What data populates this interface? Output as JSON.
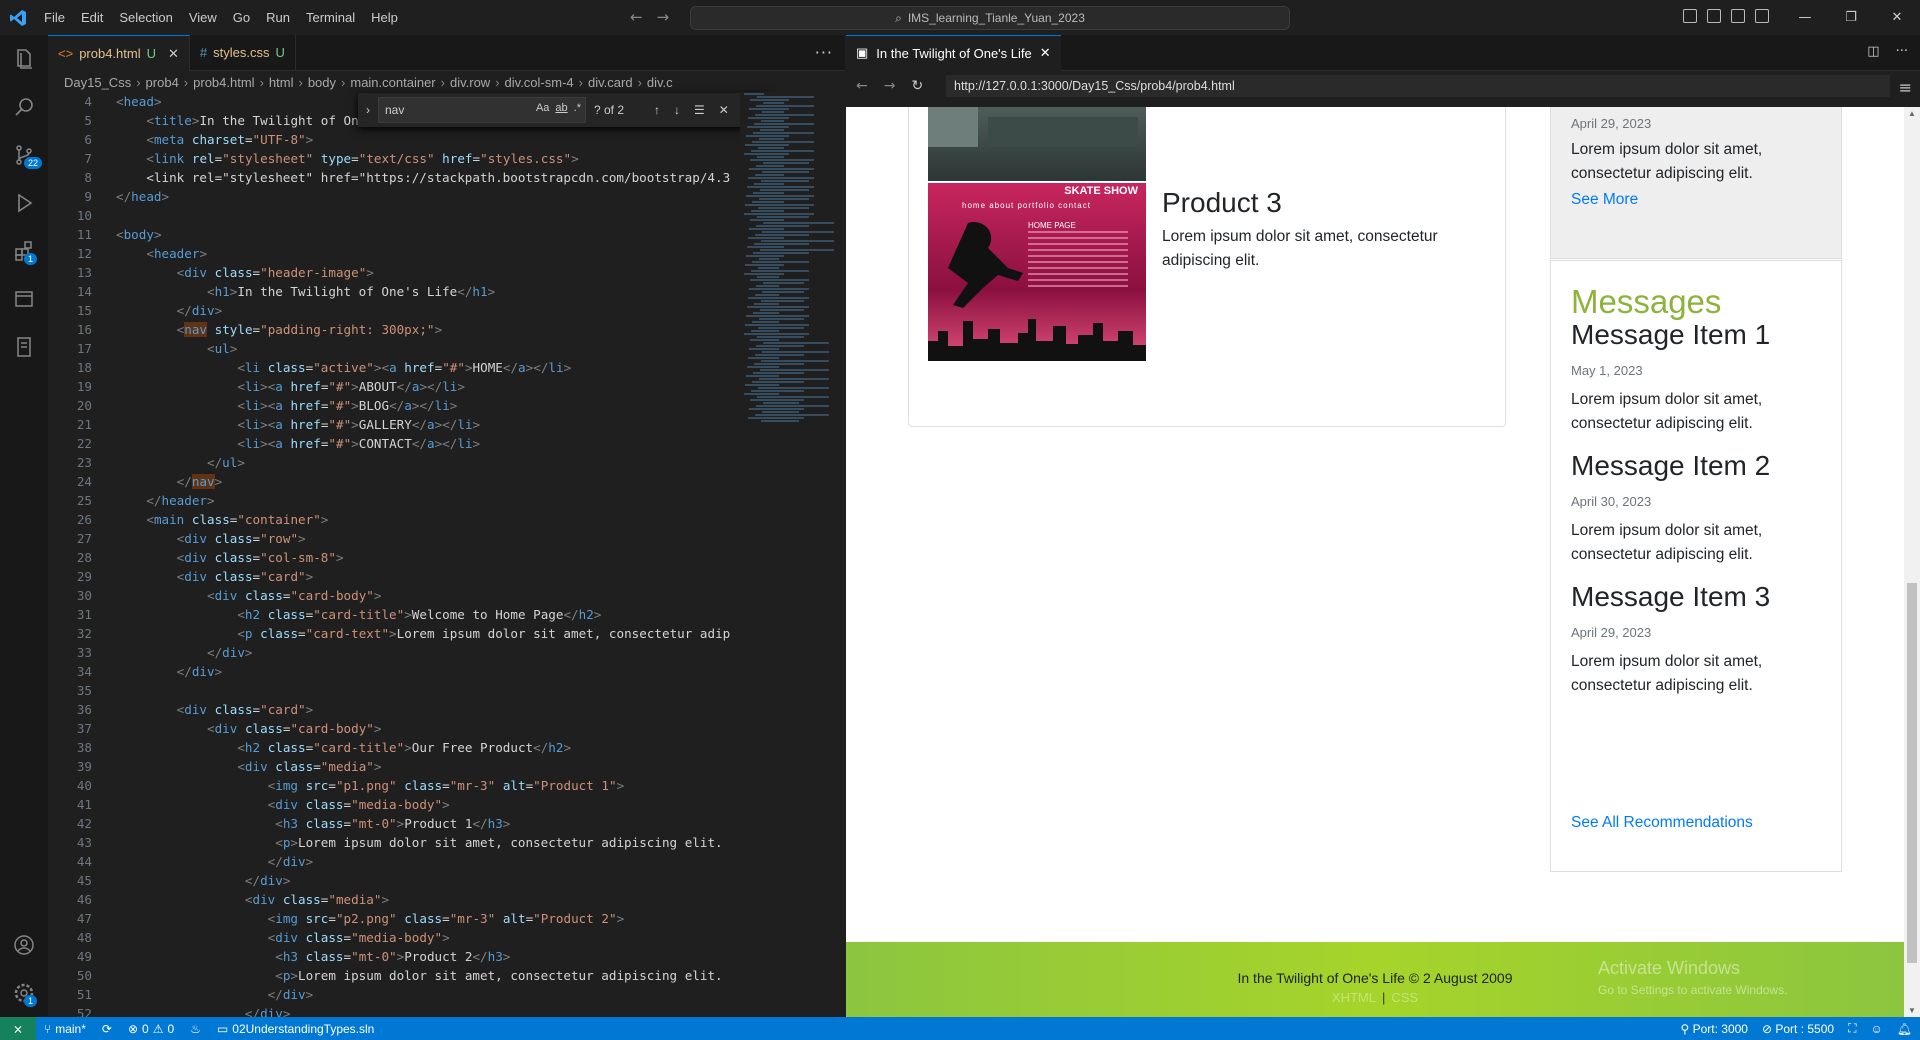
{
  "titlebar": {
    "menus": [
      "File",
      "Edit",
      "Selection",
      "View",
      "Go",
      "Run",
      "Terminal",
      "Help"
    ],
    "command_center": "IMS_learning_Tianle_Yuan_2023"
  },
  "activity": {
    "scm_badge": "22",
    "extensions_badge": "1",
    "settings_badge": "1"
  },
  "editor": {
    "tabs": [
      {
        "name": "prob4.html",
        "status": "U"
      },
      {
        "name": "styles.css",
        "status": "U"
      }
    ],
    "breadcrumb": [
      "Day15_Css",
      "prob4",
      "prob4.html",
      "html",
      "body",
      "main.container",
      "div.row",
      "div.col-sm-4",
      "div.card",
      "div.c"
    ],
    "find": {
      "query": "nav",
      "count": "? of 2",
      "opt_case": "Aa",
      "opt_word": "ab",
      "opt_regex": ".*"
    },
    "lines": [
      {
        "n": "4",
        "t": "<head>"
      },
      {
        "n": "5",
        "t": "    <title>In the Twilight of One's Life</title>"
      },
      {
        "n": "6",
        "t": "    <meta charset=\"UTF-8\">"
      },
      {
        "n": "7",
        "t": "    <link rel=\"stylesheet\" type=\"text/css\" href=\"styles.css\">"
      },
      {
        "n": "8",
        "t": "    <link rel=\"stylesheet\" href=\"https://stackpath.bootstrapcdn.com/bootstrap/4.3"
      },
      {
        "n": "9",
        "t": "</head>"
      },
      {
        "n": "10",
        "t": ""
      },
      {
        "n": "11",
        "t": "<body>"
      },
      {
        "n": "12",
        "t": "    <header>"
      },
      {
        "n": "13",
        "t": "        <div class=\"header-image\">"
      },
      {
        "n": "14",
        "t": "            <h1>In the Twilight of One's Life</h1>"
      },
      {
        "n": "15",
        "t": "        </div>"
      },
      {
        "n": "16",
        "t": "        <nav style=\"padding-right: 300px;\">"
      },
      {
        "n": "17",
        "t": "            <ul>"
      },
      {
        "n": "18",
        "t": "                <li class=\"active\"><a href=\"#\">HOME</a></li>"
      },
      {
        "n": "19",
        "t": "                <li><a href=\"#\">ABOUT</a></li>"
      },
      {
        "n": "20",
        "t": "                <li><a href=\"#\">BLOG</a></li>"
      },
      {
        "n": "21",
        "t": "                <li><a href=\"#\">GALLERY</a></li>"
      },
      {
        "n": "22",
        "t": "                <li><a href=\"#\">CONTACT</a></li>"
      },
      {
        "n": "23",
        "t": "            </ul>"
      },
      {
        "n": "24",
        "t": "        </nav>"
      },
      {
        "n": "25",
        "t": "    </header>"
      },
      {
        "n": "26",
        "t": "    <main class=\"container\">"
      },
      {
        "n": "27",
        "t": "        <div class=\"row\">"
      },
      {
        "n": "28",
        "t": "        <div class=\"col-sm-8\">"
      },
      {
        "n": "29",
        "t": "        <div class=\"card\">"
      },
      {
        "n": "30",
        "t": "            <div class=\"card-body\">"
      },
      {
        "n": "31",
        "t": "                <h2 class=\"card-title\">Welcome to Home Page</h2>"
      },
      {
        "n": "32",
        "t": "                <p class=\"card-text\">Lorem ipsum dolor sit amet, consectetur adip"
      },
      {
        "n": "33",
        "t": "            </div>"
      },
      {
        "n": "34",
        "t": "        </div>"
      },
      {
        "n": "35",
        "t": ""
      },
      {
        "n": "36",
        "t": "        <div class=\"card\">"
      },
      {
        "n": "37",
        "t": "            <div class=\"card-body\">"
      },
      {
        "n": "38",
        "t": "                <h2 class=\"card-title\">Our Free Product</h2>"
      },
      {
        "n": "39",
        "t": "                <div class=\"media\">"
      },
      {
        "n": "40",
        "t": "                    <img src=\"p1.png\" class=\"mr-3\" alt=\"Product 1\">"
      },
      {
        "n": "41",
        "t": "                    <div class=\"media-body\">"
      },
      {
        "n": "42",
        "t": "                     <h3 class=\"mt-0\">Product 1</h3>"
      },
      {
        "n": "43",
        "t": "                     <p>Lorem ipsum dolor sit amet, consectetur adipiscing elit."
      },
      {
        "n": "44",
        "t": "                    </div>"
      },
      {
        "n": "45",
        "t": "                 </div>"
      },
      {
        "n": "46",
        "t": "                 <div class=\"media\">"
      },
      {
        "n": "47",
        "t": "                    <img src=\"p2.png\" class=\"mr-3\" alt=\"Product 2\">"
      },
      {
        "n": "48",
        "t": "                    <div class=\"media-body\">"
      },
      {
        "n": "49",
        "t": "                     <h3 class=\"mt-0\">Product 2</h3>"
      },
      {
        "n": "50",
        "t": "                     <p>Lorem ipsum dolor sit amet, consectetur adipiscing elit."
      },
      {
        "n": "51",
        "t": "                    </div>"
      },
      {
        "n": "52",
        "t": "                 </div>"
      }
    ]
  },
  "preview": {
    "tab_title": "In the Twilight of One's Life",
    "url": "http://127.0.0.1:3000/Day15_Css/prob4/prob4.html",
    "product3": {
      "title": "Product 3",
      "text": "Lorem ipsum dolor sit amet, consectetur adipiscing elit."
    },
    "image2": {
      "banner": "SKATE SHOW",
      "menu": "home   about   portfolio  contact",
      "home": "HOME PAGE"
    },
    "side_top": {
      "date": "April 29, 2023",
      "text": "Lorem ipsum dolor sit amet, consectetur adipiscing elit.",
      "link": "See More"
    },
    "messages": {
      "title": "Messages",
      "items": [
        {
          "title": "Message Item 1",
          "date": "May 1, 2023",
          "text": "Lorem ipsum dolor sit amet, consectetur adipiscing elit."
        },
        {
          "title": "Message Item 2",
          "date": "April 30, 2023",
          "text": "Lorem ipsum dolor sit amet, consectetur adipiscing elit."
        },
        {
          "title": "Message Item 3",
          "date": "April 29, 2023",
          "text": "Lorem ipsum dolor sit amet, consectetur adipiscing elit."
        }
      ],
      "all_link": "See All Recommendations"
    },
    "footer": {
      "text": "In the Twilight of One's Life © 2 August 2009",
      "link1": "XHTML",
      "link2": "CSS"
    },
    "activate": {
      "line1": "Activate Windows",
      "line2": "Go to Settings to activate Windows."
    }
  },
  "statusbar": {
    "branch": "main*",
    "errors": "0",
    "warnings": "0",
    "solution": "02UnderstandingTypes.sln",
    "port1": "Port: 3000",
    "port2": "Port : 5500"
  },
  "colors": {
    "accent": "#0078d4",
    "messages": "#8db33a",
    "link": "#007bff",
    "footer": "#a6d42a"
  }
}
